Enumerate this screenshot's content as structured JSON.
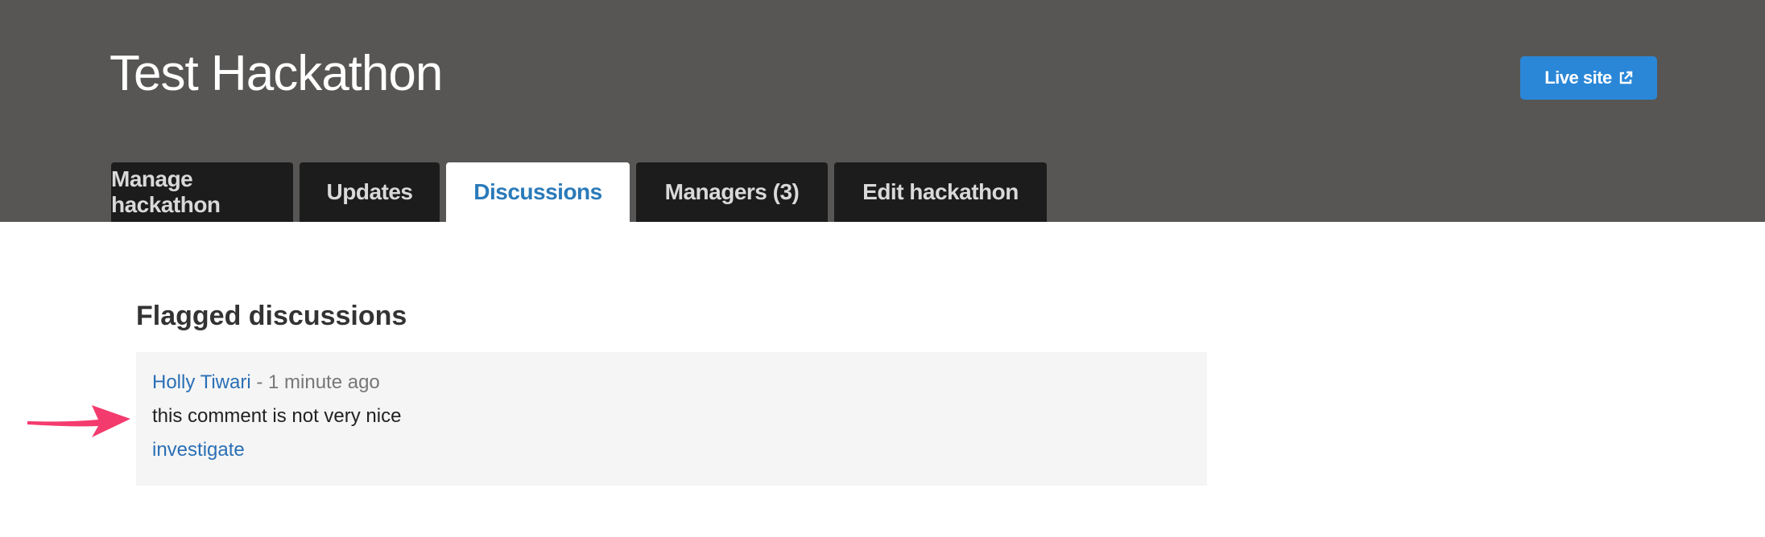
{
  "header": {
    "title": "Test Hackathon",
    "live_site_label": "Live site",
    "live_site_icon": "external-link-icon",
    "background_color": "#585654",
    "button_color": "#2a87d7"
  },
  "tabs": [
    {
      "label": "Manage hackathon",
      "active": false
    },
    {
      "label": "Updates",
      "active": false
    },
    {
      "label": "Discussions",
      "active": true
    },
    {
      "label": "Managers (3)",
      "active": false
    },
    {
      "label": "Edit hackathon",
      "active": false
    }
  ],
  "flagged": {
    "heading": "Flagged discussions",
    "items": [
      {
        "author": "Holly Tiwari",
        "separator": " - ",
        "time": "1 minute ago",
        "comment": "this comment is not very nice",
        "action": "investigate"
      }
    ]
  },
  "annotation": {
    "icon": "arrow-pointer-icon",
    "color": "#f43b6e"
  }
}
